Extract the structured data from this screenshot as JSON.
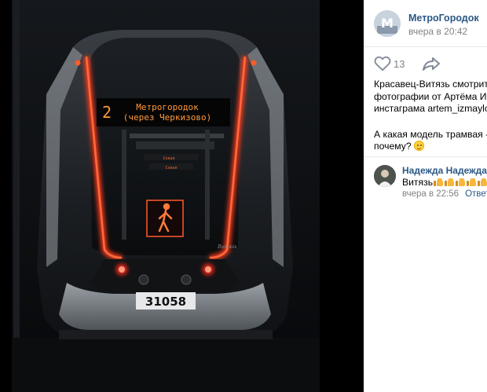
{
  "post": {
    "author": "МетроГородок",
    "time": "вчера в 20:42",
    "likes": "13",
    "text_lines": [
      "Красавец-Витязь смотрит н",
      "фотографии от Артёма Изма",
      "инстаграма artem_izmaylovs"
    ],
    "text_lines_2": [
      "А какая модель трамвая - в",
      "почему?"
    ]
  },
  "comment": {
    "author": "Надежда Надежда",
    "text": "Витязь",
    "time": "вчера в 22:56",
    "reply_label": "Ответи"
  },
  "photo": {
    "route_number": "2",
    "destination_line1": "Метрогородок",
    "destination_line2": "(через Черкизово)",
    "inner_sign1": "Сокол",
    "inner_sign2": "Сокол",
    "fleet_number": "31058",
    "signature": "Витязь"
  },
  "icons": {
    "like": "heart-icon",
    "share": "share-arrow-icon",
    "emoji": "smiling-face-emoji",
    "thumbs": "thumbs-up-emoji"
  },
  "colors": {
    "link": "#2a5885",
    "muted": "#828282",
    "tram_glow": "#ff3a1a",
    "sign_amber": "#ff9a3c"
  }
}
